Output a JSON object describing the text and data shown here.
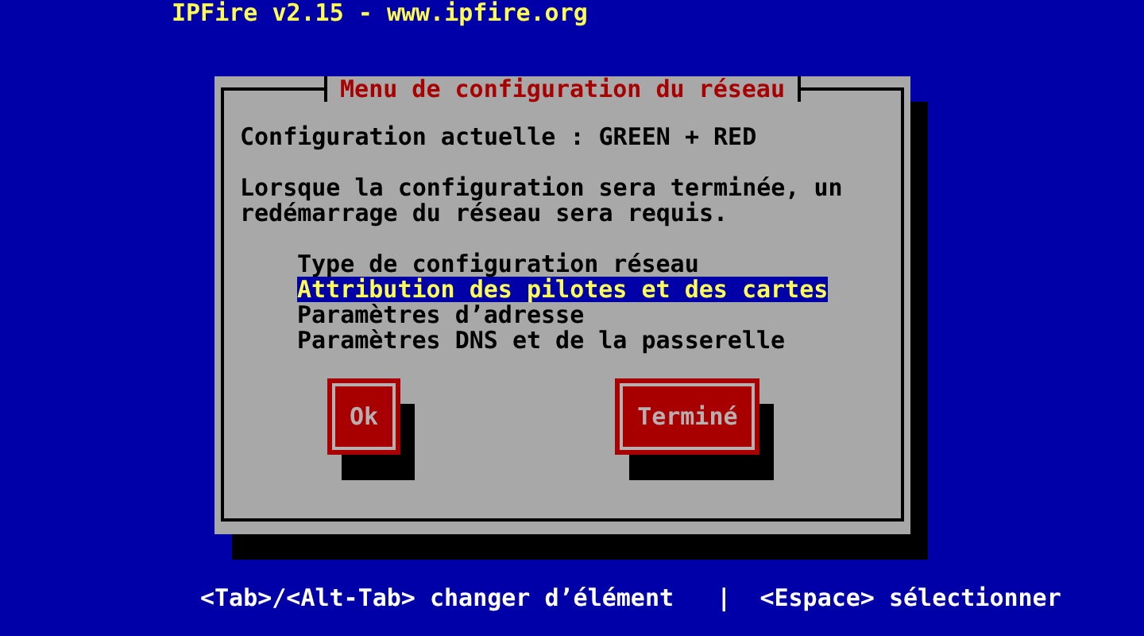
{
  "header": {
    "title": "IPFire v2.15 - www.ipfire.org"
  },
  "dialog": {
    "title": "Menu de configuration du réseau",
    "current_config": "Configuration actuelle : GREEN + RED",
    "message": "Lorsque la configuration sera terminée, un redémarrage du réseau sera requis.",
    "menu": [
      {
        "label": "Type de configuration réseau",
        "selected": false
      },
      {
        "label": "Attribution des pilotes et des cartes",
        "selected": true
      },
      {
        "label": "Paramètres d’adresse",
        "selected": false
      },
      {
        "label": "Paramètres DNS et de la passerelle",
        "selected": false
      }
    ],
    "buttons": [
      {
        "label": "Ok"
      },
      {
        "label": "Terminé"
      }
    ]
  },
  "help_line": "<Tab>/<Alt-Tab> changer d’élément   |  <Espace> sélectionner"
}
